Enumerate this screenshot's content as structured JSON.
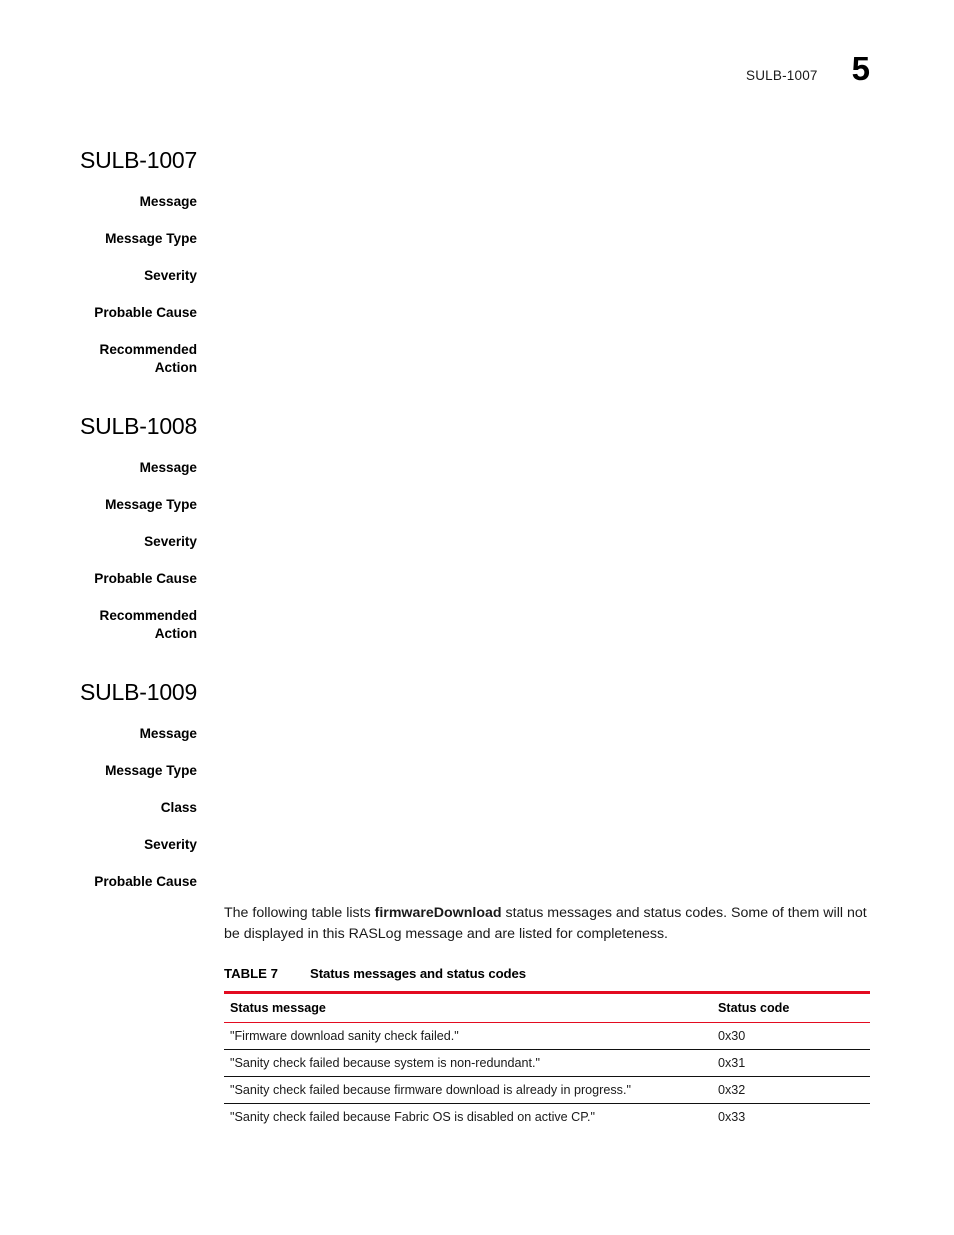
{
  "header": {
    "reference": "SULB-1007",
    "page_number": "5"
  },
  "sections": [
    {
      "title": "SULB-1007",
      "fields": [
        {
          "label": "Message",
          "value": ""
        },
        {
          "label": "Message Type",
          "value": ""
        },
        {
          "label": "Severity",
          "value": ""
        },
        {
          "label": "Probable Cause",
          "value": ""
        },
        {
          "label": "Recommended\nAction",
          "value": ""
        }
      ]
    },
    {
      "title": "SULB-1008",
      "fields": [
        {
          "label": "Message",
          "value": ""
        },
        {
          "label": "Message Type",
          "value": ""
        },
        {
          "label": "Severity",
          "value": ""
        },
        {
          "label": "Probable Cause",
          "value": ""
        },
        {
          "label": "Recommended\nAction",
          "value": ""
        }
      ]
    },
    {
      "title": "SULB-1009",
      "fields": [
        {
          "label": "Message",
          "value": ""
        },
        {
          "label": "Message Type",
          "value": ""
        },
        {
          "label": "Class",
          "value": ""
        },
        {
          "label": "Severity",
          "value": ""
        },
        {
          "label": "Probable Cause",
          "value": ""
        }
      ]
    }
  ],
  "body": {
    "paragraph_part1": "The following table lists ",
    "paragraph_bold": "firmwareDownload",
    "paragraph_part2": " status messages and status codes. Some of them will not be displayed in this RASLog message and are listed for completeness."
  },
  "table": {
    "caption_number": "TABLE 7",
    "caption_text": "Status messages and status codes",
    "columns": [
      "Status message",
      "Status code"
    ],
    "rows": [
      {
        "message": "\"Firmware download sanity check failed.\"",
        "code": "0x30"
      },
      {
        "message": "\"Sanity check failed because system is non-redundant.\"",
        "code": "0x31"
      },
      {
        "message": "\"Sanity check failed because firmware download is already in progress.\"",
        "code": "0x32"
      },
      {
        "message": "\"Sanity check failed because Fabric OS is disabled on active CP.\"",
        "code": "0x33"
      }
    ]
  },
  "colors": {
    "rule_red": "#e30b20",
    "rule_black": "#111111",
    "text": "#000000"
  }
}
